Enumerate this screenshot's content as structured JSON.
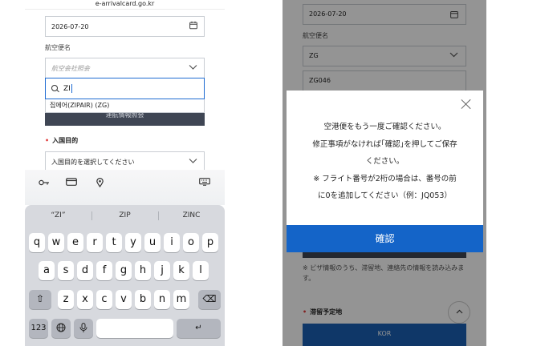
{
  "left": {
    "url": "e-arrivalcard.go.kr",
    "date_value": "2026-07-20",
    "flight_label": "航空便名",
    "airline_placeholder": "航空会社照会",
    "search_value": "ZI",
    "search_result": "집에어(ZIPAIR) (ZG)",
    "lookup_button": "運航情報照会",
    "purpose_label": "入国目的",
    "purpose_placeholder": "入国目的を選択してください",
    "toolbar_icons": [
      "key-icon",
      "card-icon",
      "location-pin-icon",
      "keyboard-icon"
    ],
    "suggestions": [
      "“ZI”",
      "ZIP",
      "ZINC"
    ],
    "keys_row1": [
      "q",
      "w",
      "e",
      "r",
      "t",
      "y",
      "u",
      "i",
      "o",
      "p"
    ],
    "keys_row2": [
      "a",
      "s",
      "d",
      "f",
      "g",
      "h",
      "j",
      "k",
      "l"
    ],
    "keys_row3": [
      "z",
      "x",
      "c",
      "v",
      "b",
      "n",
      "m"
    ],
    "key_numbers": "123",
    "shift_glyph": "⇧",
    "backspace_glyph": "⌫",
    "globe_glyph": "🌐",
    "mic_glyph": "🎤",
    "return_glyph": "↵"
  },
  "right": {
    "date_value": "2026-07-20",
    "flight_label": "航空便名",
    "airline_value": "ZG",
    "flight_number": "ZG046",
    "modal_message": "空港便をもう一度ご確認ください。\n修正事項がなければ「確認」を押してご保存ください。\n※ フライト番号が2桁の場合は、番号の前に0を追加してください（例：JQ053）",
    "modal_line1": "空港便をもう一度ご確認ください。",
    "modal_line2": "修正事項がなければ｢確認｣を押してご保存",
    "modal_line3": "ください。",
    "modal_line4": "※ フライト番号が2桁の場合は、番号の前",
    "modal_line5": "に0を追加してください（例：JQ053）",
    "confirm_label": "確認",
    "note_text": "※ ビザ情報のうち、滞留地、連絡先の情報を読み込みます。",
    "stay_label": "滞留予定地",
    "country_value": "KOR"
  },
  "colors": {
    "primary": "#1464c8",
    "dark_button": "#3f4654",
    "required_dot": "#e03c3c",
    "focus_border": "#1e6bd2"
  }
}
